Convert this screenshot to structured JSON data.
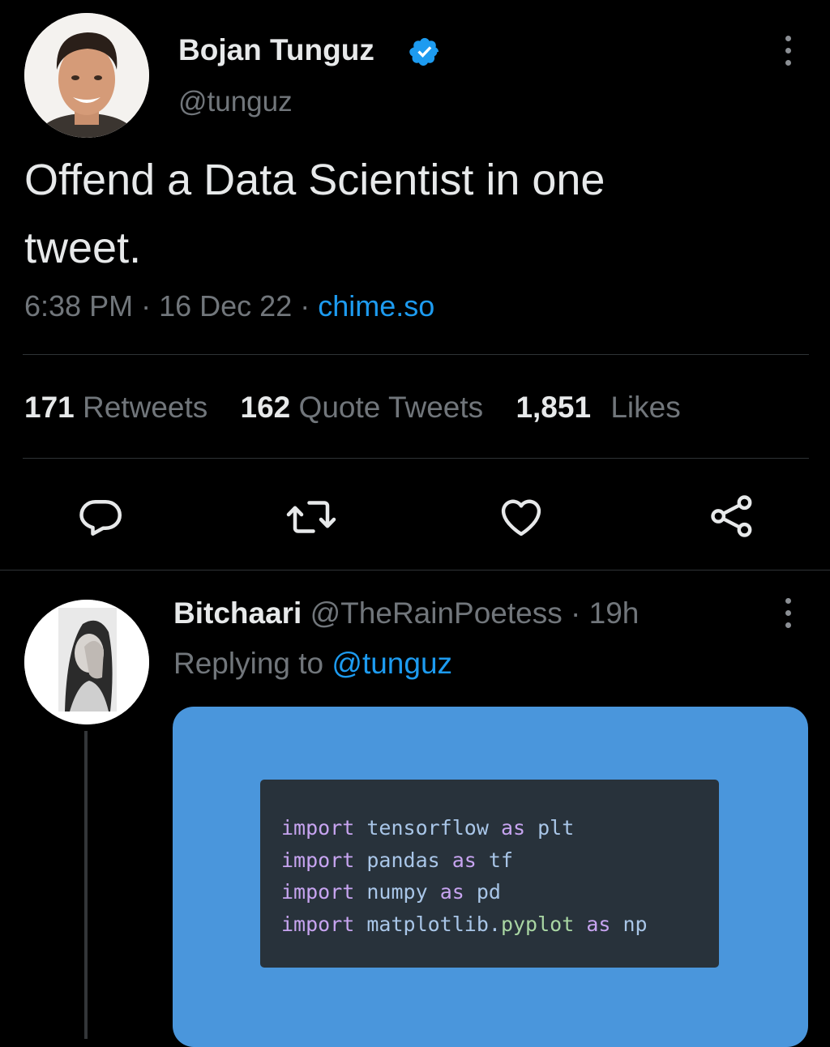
{
  "tweet": {
    "author_name": "Bojan Tunguz",
    "author_handle": "@tunguz",
    "text_line1": "Offend a Data Scientist in one",
    "text_line2": "tweet.",
    "time": "6:38 PM",
    "sep1": "·",
    "date": "16 Dec 22",
    "sep2": "·",
    "source": "chime.so",
    "stats": {
      "retweets_count": "171",
      "retweets_label": "Retweets",
      "quotes_count": "162",
      "quotes_label": "Quote Tweets",
      "likes_count": "1,851",
      "likes_label": "Likes"
    },
    "actions": [
      "reply-icon",
      "retweet-icon",
      "like-icon",
      "share-icon"
    ]
  },
  "reply": {
    "author_name": "Bitchaari",
    "author_handle": "@TheRainPoetess",
    "sep": "·",
    "age": "19h",
    "replying_label": "Replying to",
    "replying_handle": "@tunguz",
    "code": [
      {
        "kw1": "import",
        "mod": "tensorflow",
        "kw2": "as",
        "alias": "plt"
      },
      {
        "kw1": "import",
        "mod": "pandas",
        "kw2": "as",
        "alias": "tf"
      },
      {
        "kw1": "import",
        "mod": "numpy",
        "kw2": "as",
        "alias": "pd"
      },
      {
        "kw1": "import",
        "mod": "matplotlib",
        "dot": ".",
        "mod2": "pyplot",
        "kw2": "as",
        "alias": "np"
      }
    ]
  },
  "colors": {
    "background": "#000000",
    "link": "#1d9bf0",
    "verified": "#1d9bf0",
    "card": "#4a96dc",
    "code_bg": "#28323b"
  }
}
